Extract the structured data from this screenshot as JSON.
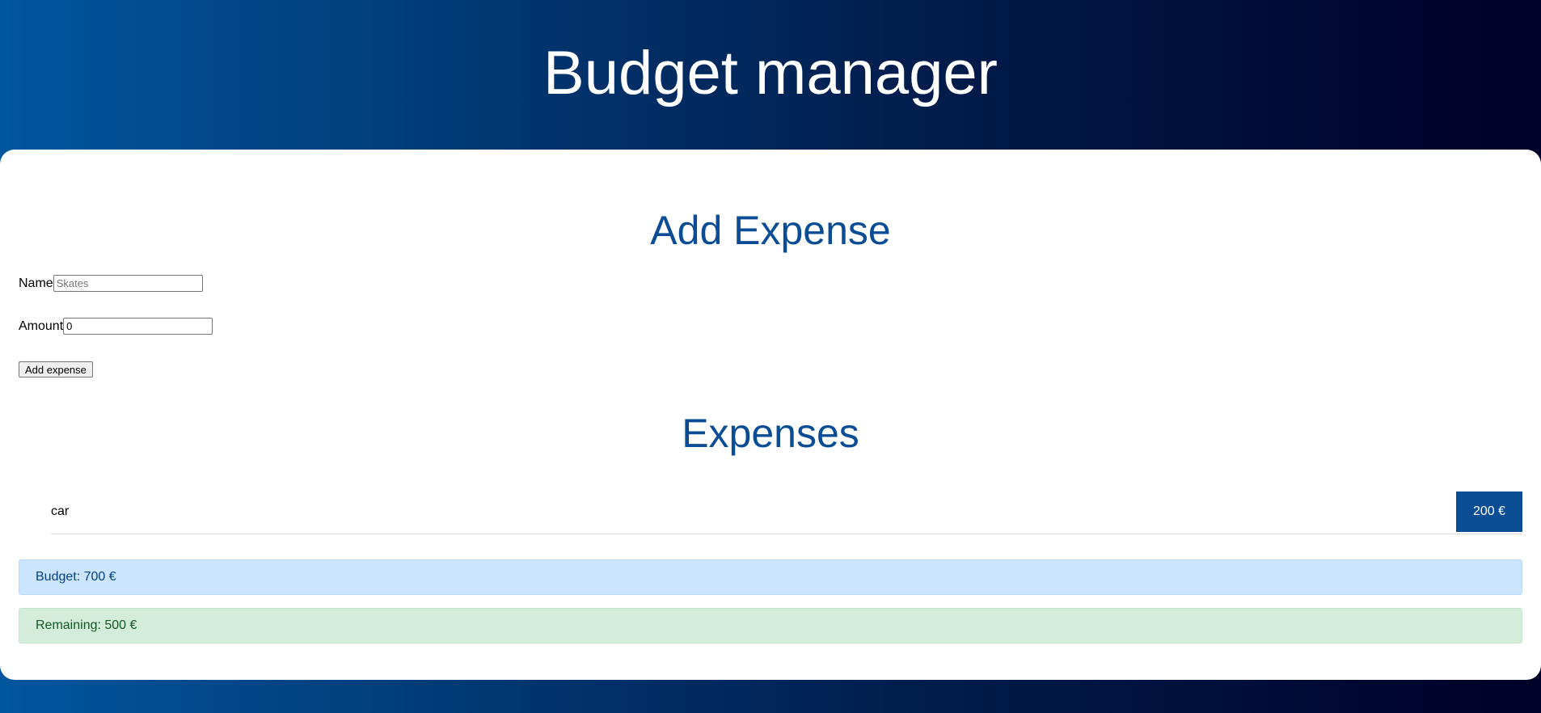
{
  "header": {
    "title": "Budget manager"
  },
  "form": {
    "title": "Add Expense",
    "name_label": "Name",
    "name_placeholder": "Skates",
    "name_value": "",
    "amount_label": "Amount",
    "amount_value": "0",
    "submit_label": "Add expense"
  },
  "expenses": {
    "title": "Expenses",
    "items": [
      {
        "name": "car",
        "amount": "200 €"
      }
    ]
  },
  "summary": {
    "budget": "Budget: 700 €",
    "remaining": "Remaining: 500 €"
  },
  "colors": {
    "header_gradient_start": "#01569e",
    "header_gradient_end": "#000028",
    "accent": "#0a4d94",
    "budget_bg": "#cce5fe",
    "remaining_bg": "#d4edda"
  }
}
